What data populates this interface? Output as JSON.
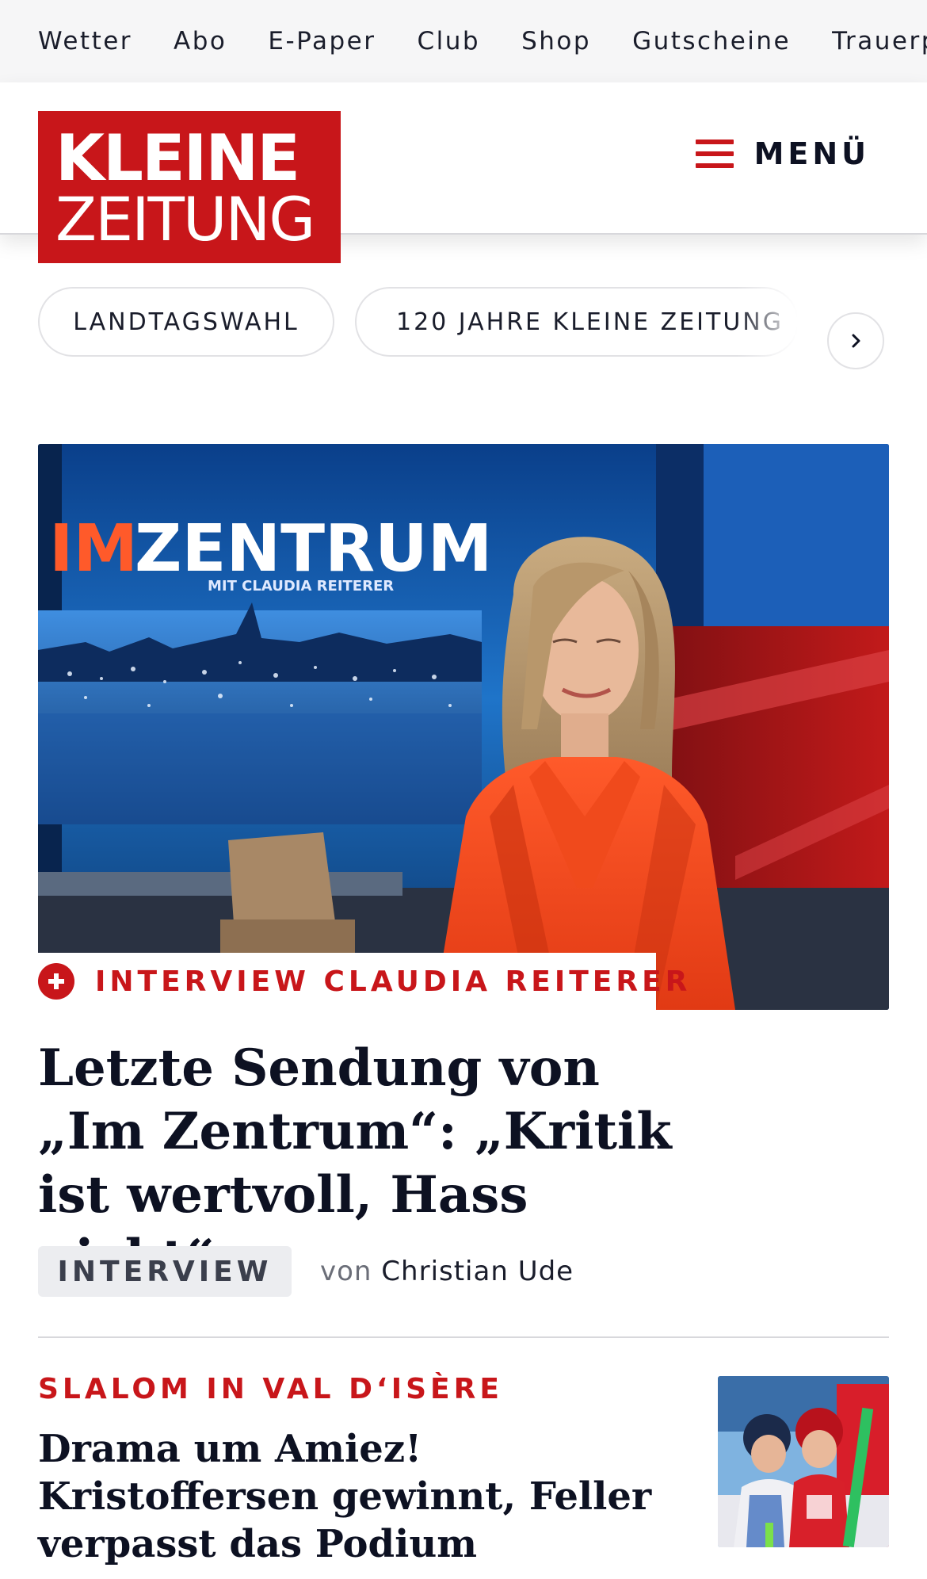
{
  "topnav": {
    "items": [
      "Wetter",
      "Abo",
      "E-Paper",
      "Club",
      "Shop",
      "Gutscheine",
      "Trauerportal"
    ]
  },
  "header": {
    "logo_line1": "KLEINE",
    "logo_line2": "ZEITUNG",
    "menu_label": "MENÜ"
  },
  "topics": {
    "chips": [
      "LANDTAGSWAHL",
      "120 JAHRE KLEINE ZEITUNG"
    ]
  },
  "lead_article": {
    "image_overlay_title_part1": "IM",
    "image_overlay_title_part2": "ZENTRUM",
    "image_overlay_subtitle": "MIT CLAUDIA REITERER",
    "kicker": "INTERVIEW CLAUDIA REITERER",
    "headline": "Letzte Sendung von „Im Zentrum“: „Kritik ist wertvoll, Hass nicht“",
    "badge": "INTERVIEW",
    "byline_prefix": "von",
    "author": "Christian Ude"
  },
  "second_article": {
    "kicker": "SLALOM IN VAL D‘ISÈRE",
    "headline": "Drama um Amiez! Kristoffersen gewinnt, Feller verpasst das Podium"
  },
  "colors": {
    "brand_red": "#c8161a",
    "text_dark": "#0d1122",
    "topnav_bg": "#f6f6f7"
  }
}
